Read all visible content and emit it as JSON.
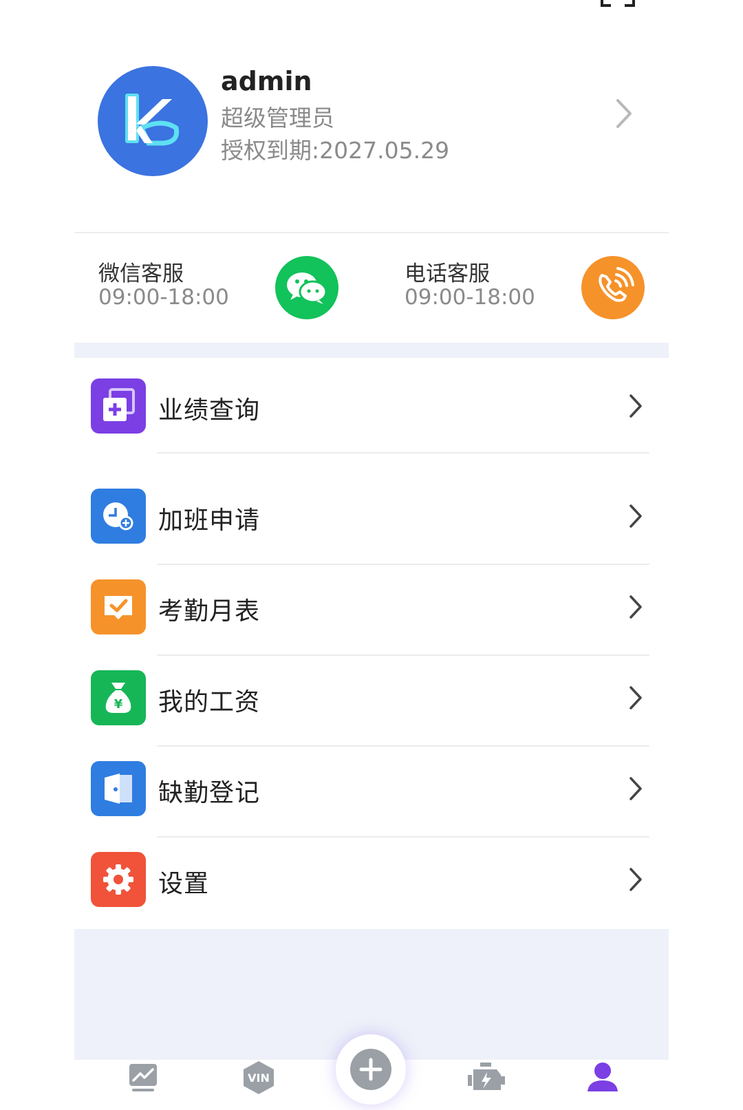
{
  "profile": {
    "username": "admin",
    "role": "超级管理员",
    "expiry": "授权到期:2027.05.29",
    "avatar_icon": "k-logo-icon"
  },
  "service": {
    "wechat": {
      "title": "微信客服",
      "hours": "09:00-18:00",
      "icon": "wechat-icon",
      "color": "#12c25a"
    },
    "phone": {
      "title": "电话客服",
      "hours": "09:00-18:00",
      "icon": "phone-icon",
      "color": "#f6922a"
    }
  },
  "menu": [
    {
      "label": "业绩查询",
      "icon": "performance-query-icon",
      "color": "#7b3fe4"
    },
    {
      "label": "加班申请",
      "icon": "overtime-clock-icon",
      "color": "#2f7de1"
    },
    {
      "label": "考勤月表",
      "icon": "attendance-check-icon",
      "color": "#f6922a"
    },
    {
      "label": "我的工资",
      "icon": "money-bag-icon",
      "color": "#16b657"
    },
    {
      "label": "缺勤登记",
      "icon": "door-icon",
      "color": "#2f7de1"
    },
    {
      "label": "设置",
      "icon": "gear-icon",
      "color": "#f0533a"
    }
  ],
  "tabbar": {
    "items": [
      {
        "icon": "stats-chart-icon"
      },
      {
        "icon": "vin-badge-icon",
        "text": "VIN"
      },
      {
        "icon": "add-icon"
      },
      {
        "icon": "engine-icon"
      },
      {
        "icon": "user-profile-icon"
      }
    ],
    "active_color": "#7b3fe4"
  }
}
